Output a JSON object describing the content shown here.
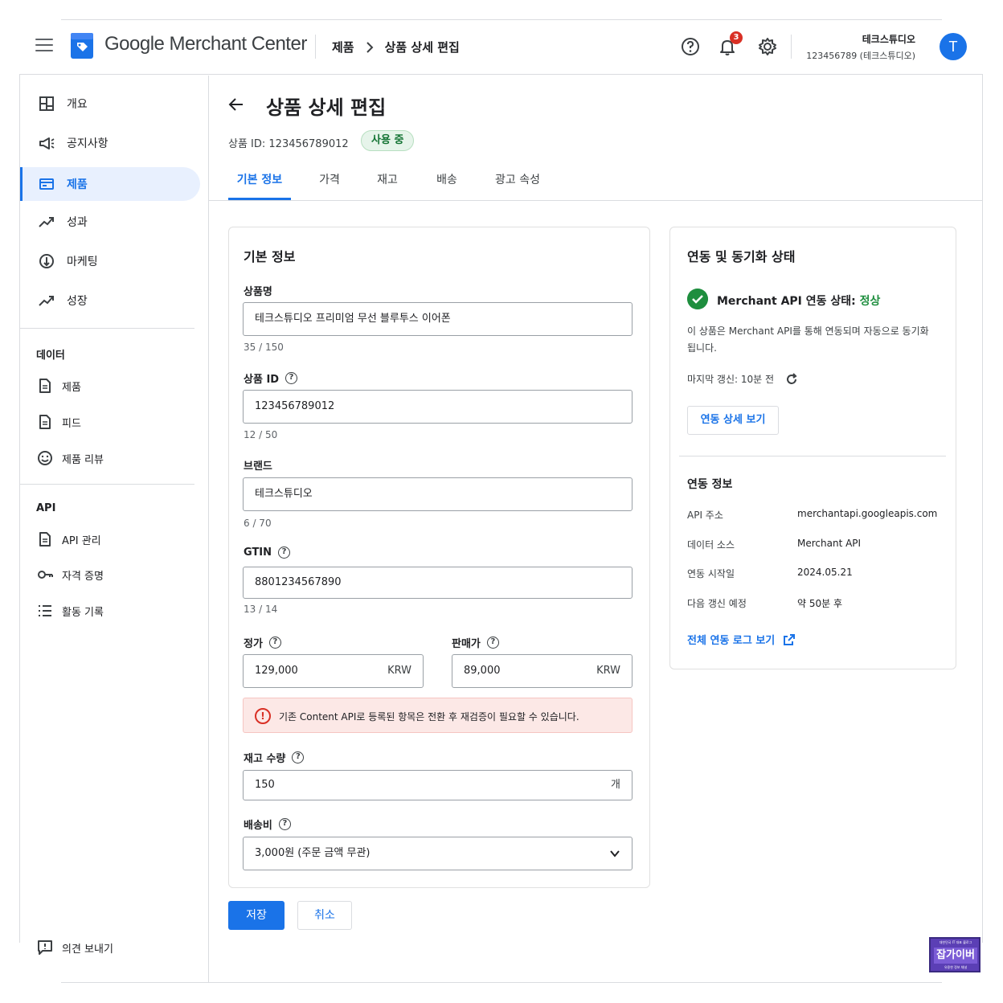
{
  "header": {
    "brand_google": "Google",
    "brand_rest": " Merchant Center",
    "breadcrumb": [
      "제품",
      "상품 상세 편집"
    ],
    "notification_count": "3",
    "account_name": "테크스튜디오",
    "account_id": "123456789 (테크스튜디오)",
    "avatar_letter": "T"
  },
  "sidebar": {
    "main_items": [
      {
        "label": "개요",
        "icon": "dashboard-icon"
      },
      {
        "label": "공지사항",
        "icon": "megaphone-icon"
      },
      {
        "label": "제품",
        "icon": "products-icon",
        "active": true
      },
      {
        "label": "성과",
        "icon": "trending-icon"
      },
      {
        "label": "마케팅",
        "icon": "marketing-icon"
      },
      {
        "label": "성장",
        "icon": "growth-icon"
      }
    ],
    "data_section_title": "데이터",
    "data_items": [
      {
        "label": "제품",
        "icon": "document-icon"
      },
      {
        "label": "피드",
        "icon": "document-icon"
      },
      {
        "label": "제품 리뷰",
        "icon": "review-icon"
      }
    ],
    "api_section_title": "API",
    "api_items": [
      {
        "label": "API 관리",
        "icon": "document-icon"
      },
      {
        "label": "자격 증명",
        "icon": "key-icon"
      },
      {
        "label": "활동 기록",
        "icon": "list-icon"
      }
    ],
    "feedback_label": "의견 보내기"
  },
  "page": {
    "title": "상품 상세 편집",
    "product_id_text": "상품 ID: 123456789012",
    "status": "사용 중",
    "tabs": [
      "기본 정보",
      "가격",
      "재고",
      "배송",
      "광고 속성"
    ]
  },
  "form": {
    "card_title": "기본 정보",
    "name_label": "상품명",
    "name_value": "테크스튜디오 프리미엄 무선 블루투스 이어폰",
    "name_counter": "35 / 150",
    "pid_label": "상품 ID",
    "pid_value": "123456789012",
    "pid_counter": "12 / 50",
    "brand_label": "브랜드",
    "brand_value": "테크스튜디오",
    "brand_counter": "6 / 70",
    "gtin_label": "GTIN",
    "gtin_value": "8801234567890",
    "gtin_counter": "13 / 14",
    "price_label": "정가",
    "price_value": "129,000",
    "price_unit": "KRW",
    "sale_label": "판매가",
    "sale_value": "89,000",
    "sale_unit": "KRW",
    "warning": "기존 Content API로 등록된 항목은 전환 후 재검증이 필요할 수 있습니다.",
    "stock_label": "재고 수량",
    "stock_value": "150",
    "stock_unit": "개",
    "shipping_label": "배송비",
    "shipping_value": "3,000원 (주문 금액 무관)",
    "save_label": "저장",
    "cancel_label": "취소"
  },
  "sync": {
    "card_title": "연동 및 동기화 상태",
    "status_prefix": "Merchant API 연동 상태: ",
    "status_value": "정상",
    "description": "이 상품은 Merchant API를 통해 연동되며 자동으로 동기화됩니다.",
    "last_sync": "마지막 갱신: 10분 전",
    "detail_button": "연동 상세 보기",
    "info_title": "연동 정보",
    "info_rows": [
      {
        "key": "API 주소",
        "value": "merchantapi.googleapis.com"
      },
      {
        "key": "데이터 소스",
        "value": "Merchant API"
      },
      {
        "key": "연동 시작일",
        "value": "2024.05.21"
      },
      {
        "key": "다음 갱신 예정",
        "value": "약 50분 후"
      }
    ],
    "log_link": "전체 연동 로그 보기"
  },
  "watermark": {
    "top": "대한민국 IT 대표 블로그",
    "main": "잡가이버",
    "bottom": "유용한 정보 채널"
  },
  "colors": {
    "accent": "#1a73e8",
    "success": "#1e8e3e",
    "error": "#d93025"
  }
}
